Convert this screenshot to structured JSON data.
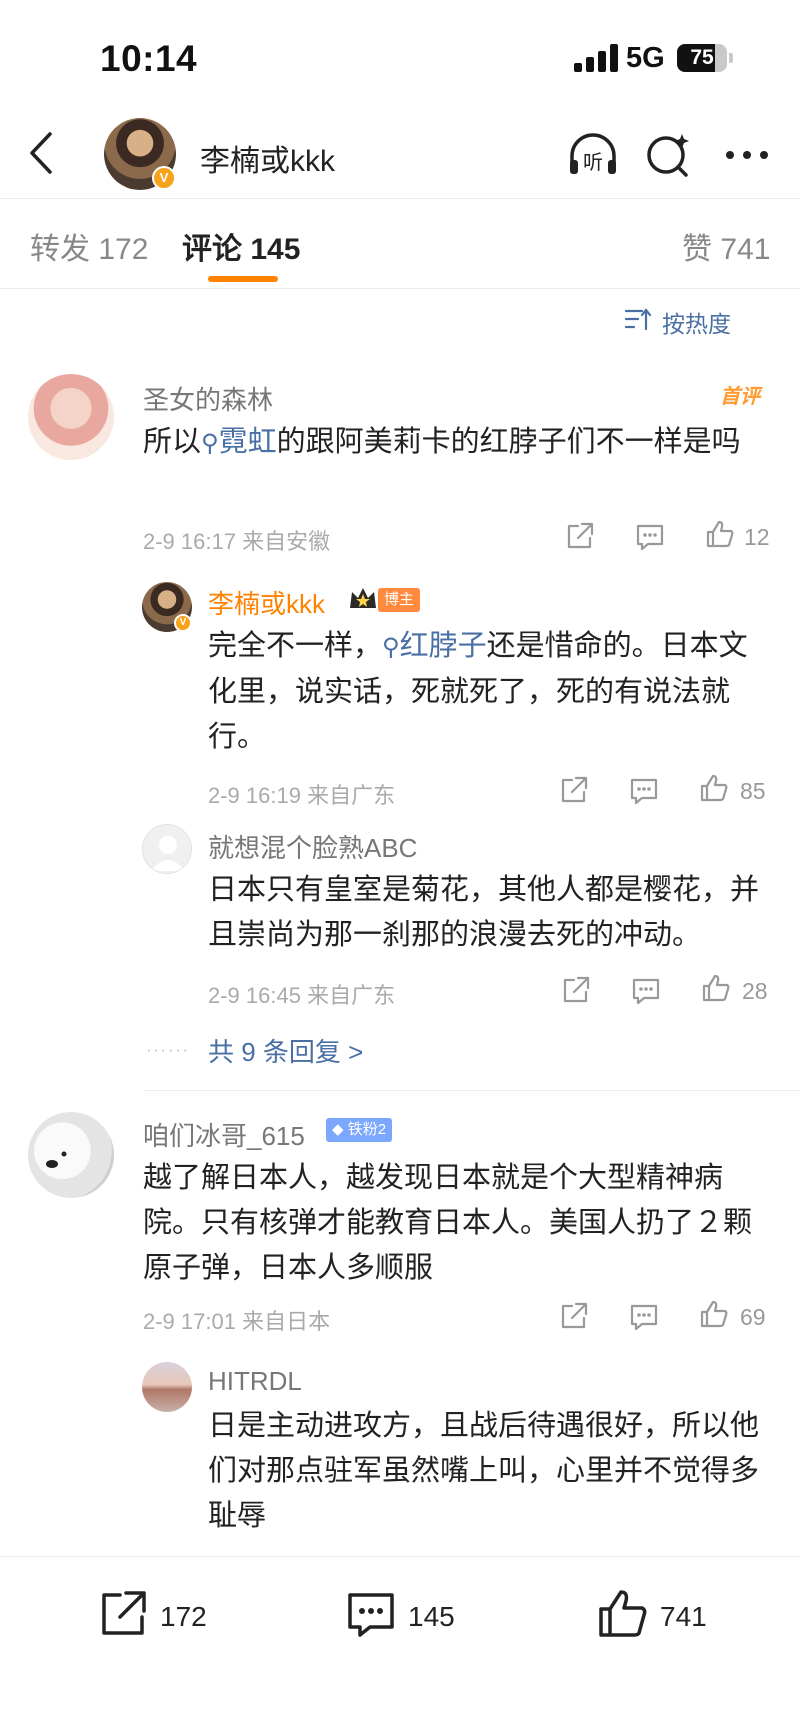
{
  "status": {
    "time": "10:14",
    "network": "5G",
    "battery": "75",
    "battery_level": 0.75
  },
  "nav": {
    "title": "李楠或kkk",
    "listen_label": "听"
  },
  "tabs": [
    {
      "label": "转发 172"
    },
    {
      "label": "评论 145"
    },
    {
      "label": "赞 741"
    }
  ],
  "sort_label": "按热度",
  "comments": [
    {
      "name": "圣女的森林",
      "badge": "首评",
      "text_pre": "所以",
      "topic": "霓虹",
      "text_post": "的跟阿美莉卡的红脖子们不一样是吗",
      "meta": "2-9 16:17  来自安徽",
      "likes": "12"
    },
    {
      "name": "咱们冰哥_615",
      "fan_tag": "铁粉2",
      "text": "越了解日本人，越发现日本就是个大型精神病院。只有核弹才能教育日本人。美国人扔了２颗原子弹，日本人多顺服",
      "meta": "2-9 17:01  来自日本",
      "likes": "69"
    }
  ],
  "replies": [
    {
      "name": "李楠或kkk",
      "tag": "博主",
      "text_pre": "完全不一样，",
      "topic": "红脖子",
      "text_post": "还是惜命的。日本文化里，说实话，死就死了，死的有说法就行。",
      "meta": "2-9 16:19  来自广东",
      "likes": "85"
    },
    {
      "name": "就想混个脸熟ABC",
      "text": "日本只有皇室是菊花，其他人都是樱花，并且崇尚为那一刹那的浪漫去死的冲动。",
      "meta": "2-9 16:45  来自广东",
      "likes": "28"
    },
    {
      "name": "HITRDL",
      "text": "日是主动进攻方，且战后待遇很好，所以他们对那点驻军虽然嘴上叫，心里并不觉得多耻辱"
    }
  ],
  "more_replies": "共 9 条回复 >",
  "bottom": {
    "reposts": "172",
    "comments": "145",
    "likes": "741"
  },
  "colors": {
    "accent": "#ff8200",
    "link": "#4a6fa5",
    "muted": "#aaaaaa",
    "fan_tag": "#7ba7ff"
  },
  "icons": [
    "back-arrow-icon",
    "headphones-icon",
    "search-sparkle-icon",
    "more-dots-icon",
    "sort-icon",
    "share-icon",
    "comment-icon",
    "like-icon",
    "search-icon"
  ]
}
